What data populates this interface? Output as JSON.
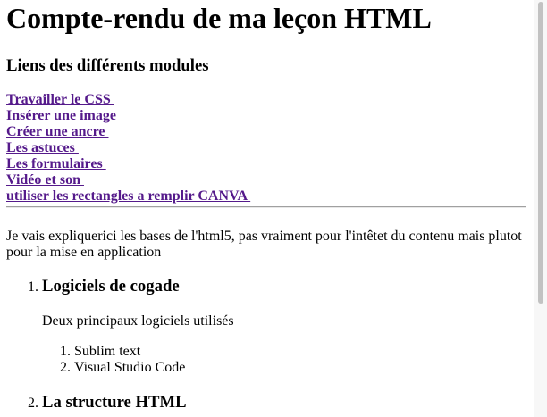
{
  "page": {
    "title": "Compte-rendu de ma leçon HTML",
    "modules_heading": "Liens des différents modules",
    "links": [
      "Travailler le CSS ",
      "Insérer une image ",
      "Créer une ancre ",
      "Les astuces ",
      "Les formulaires ",
      "Vidéo et son ",
      "utiliser les rectangles a remplir CANVA "
    ],
    "intro": "Je vais expliquerici les bases de l'html5, pas vraiment pour l'intêtet du contenu mais plutot pour la mise en application",
    "sections": [
      {
        "number": "1.",
        "title": "Logiciels de cogade",
        "text": "Deux principaux logiciels utilisés",
        "software": [
          {
            "number": "1.",
            "name": "Sublim text"
          },
          {
            "number": "2.",
            "name": "Visual Studio Code"
          }
        ]
      },
      {
        "number": "2.",
        "title": "La structure HTML"
      }
    ]
  },
  "colors": {
    "link": "#551a8b",
    "text": "#000000",
    "background": "#ffffff",
    "rule": "#a0a0a0"
  }
}
